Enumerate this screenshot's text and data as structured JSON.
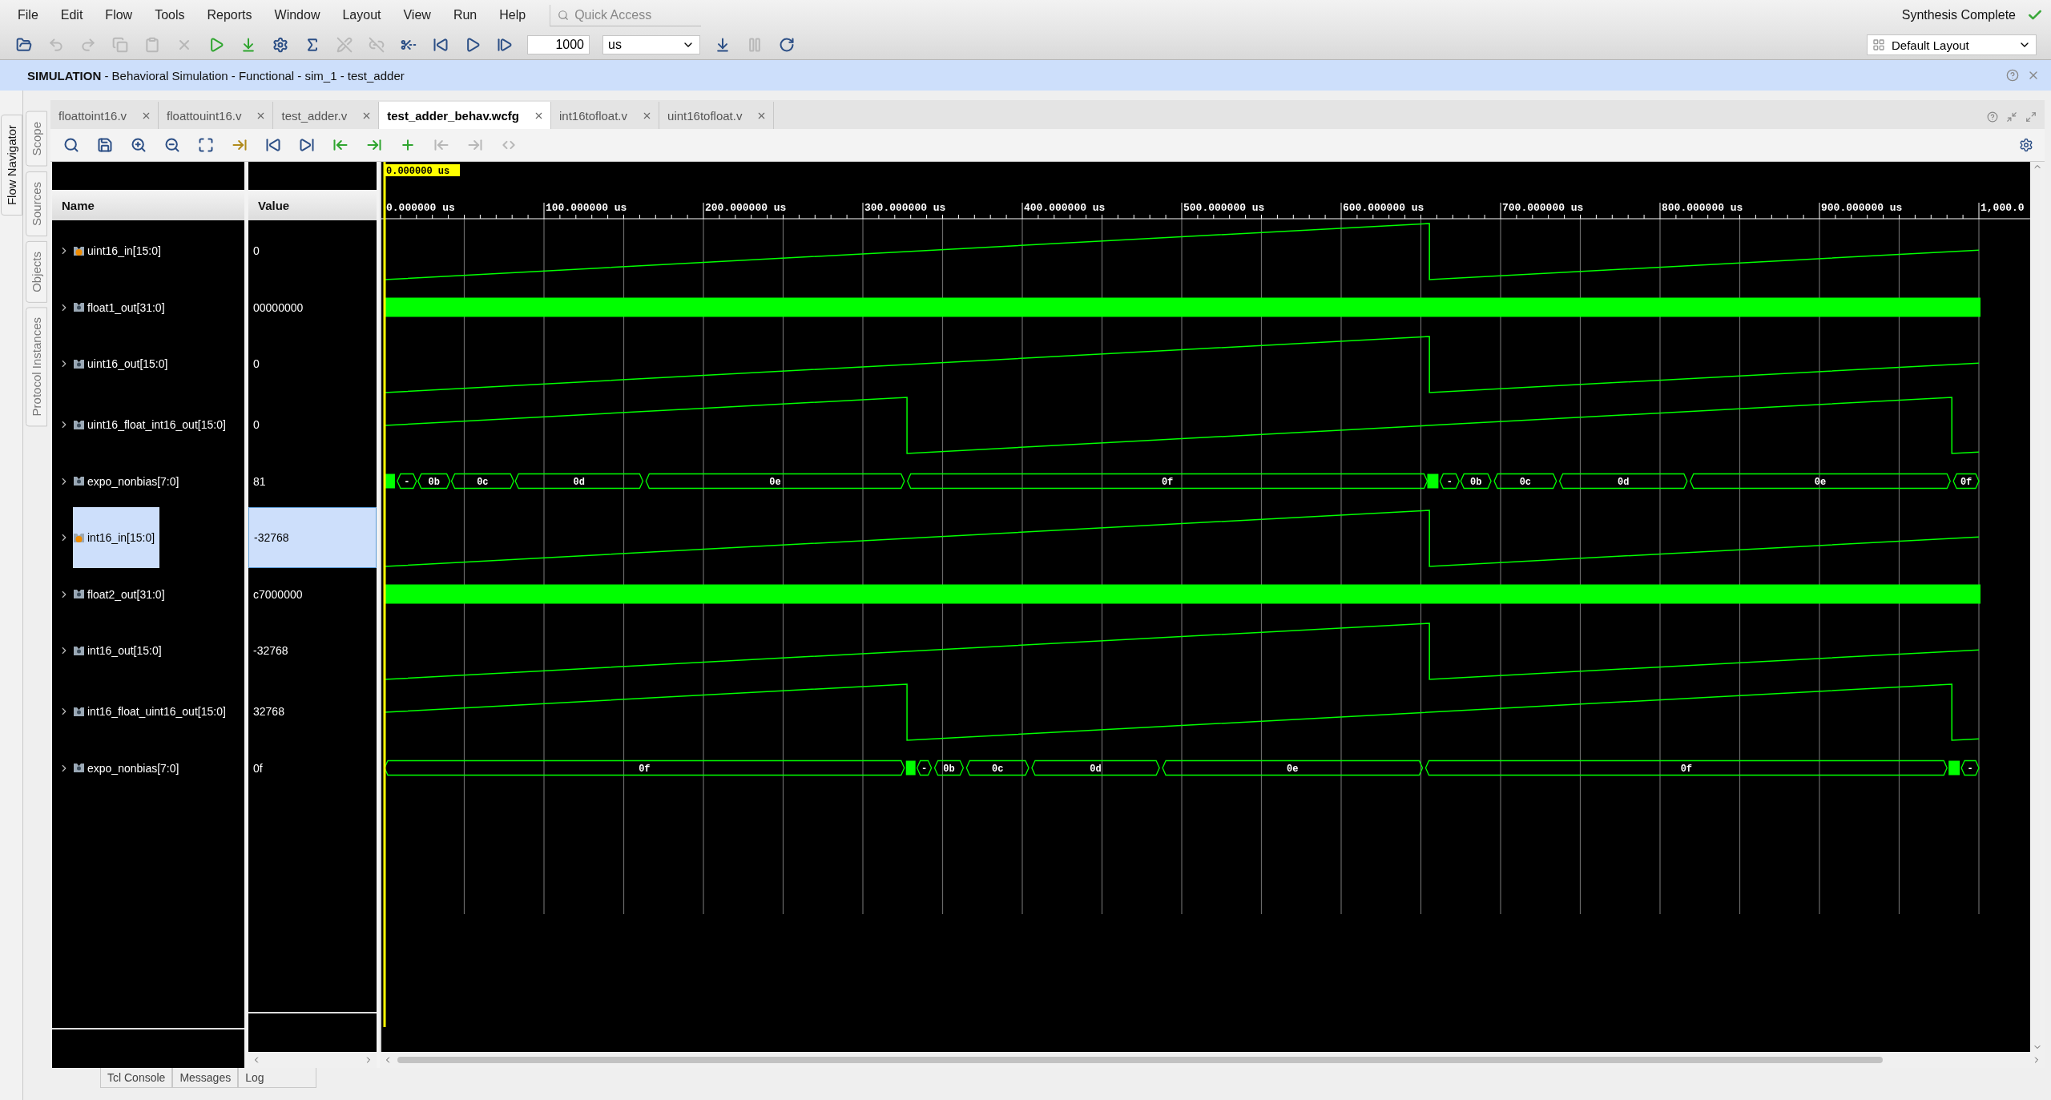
{
  "menu": [
    "File",
    "Edit",
    "Flow",
    "Tools",
    "Reports",
    "Window",
    "Layout",
    "View",
    "Run",
    "Help"
  ],
  "quick_access": {
    "placeholder": "Quick Access"
  },
  "status": "Synthesis Complete",
  "toolbar": [
    {
      "disabled": false
    },
    {
      "disabled": true
    },
    {
      "disabled": true
    },
    {
      "disabled": true
    },
    {
      "disabled": true
    },
    {
      "disabled": true
    },
    {
      "disabled": false
    },
    {
      "disabled": false
    },
    {
      "disabled": false
    },
    {
      "disabled": false
    },
    {
      "disabled": true
    },
    {
      "disabled": true
    },
    {
      "disabled": false
    },
    {
      "disabled": false
    },
    {
      "disabled": false
    },
    {
      "disabled": false
    }
  ],
  "run_time": {
    "value": "1000",
    "unit": "us"
  },
  "toolbar_right": [
    {
      "disabled": false
    },
    {
      "disabled": true
    },
    {
      "disabled": false
    }
  ],
  "layout_select": "Default Layout",
  "header": "**SIMULATION** - Behavioral Simulation - Functional - sim_1 - test_adder",
  "side_tabs": [
    "Flow Navigator"
  ],
  "panel_tabs": [
    "Scope",
    "Sources",
    "Objects",
    "Protocol Instances"
  ],
  "editor_tabs": [
    {
      "label": "floattoint16.v",
      "selected": false
    },
    {
      "label": "floattouint16.v",
      "selected": false
    },
    {
      "label": "test_adder.v",
      "selected": false
    },
    {
      "label": "test_adder_behav.wcfg",
      "selected": true
    },
    {
      "label": "int16tofloat.v",
      "selected": false
    },
    {
      "label": "uint16tofloat.v",
      "selected": false
    }
  ],
  "wave_toolbar": [
    {
      "disabled": false
    },
    {
      "disabled": false
    },
    {
      "disabled": false
    },
    {
      "disabled": false
    },
    {
      "disabled": false
    },
    {
      "disabled": false
    },
    {
      "disabled": false
    },
    {
      "disabled": false
    },
    {
      "disabled": false
    },
    {
      "disabled": false
    },
    {
      "disabled": false
    },
    {
      "disabled": true
    },
    {
      "disabled": true
    },
    {
      "disabled": true
    }
  ],
  "waveform": {
    "cursor": "0.000000 us",
    "columns": [
      "Name",
      "Value"
    ],
    "time_labels": [
      "0.000000 us",
      "100.000000 us",
      "200.000000 us",
      "300.000000 us",
      "400.000000 us",
      "500.000000 us",
      "600.000000 us",
      "700.000000 us",
      "800.000000 us",
      "900.000000 us",
      "1,000.0"
    ],
    "signals": [
      {
        "name": "uint16_in[15:0]",
        "value": "0",
        "kind": "analog",
        "input": true,
        "expanded": false,
        "selected": false
      },
      {
        "name": "float1_out[31:0]",
        "value": "00000000",
        "kind": "dense",
        "input": false,
        "expanded": false,
        "selected": false
      },
      {
        "name": "uint16_out[15:0]",
        "value": "0",
        "kind": "analog",
        "input": false,
        "expanded": false,
        "selected": false
      },
      {
        "name": "uint16_float_int16_out[15:0]",
        "value": "0",
        "kind": "analog",
        "input": false,
        "expanded": false,
        "selected": false
      },
      {
        "name": "expo_nonbias[7:0]",
        "value": "81",
        "kind": "bus",
        "input": false,
        "expanded": false,
        "selected": false,
        "segments": [
          "-",
          "0b",
          "0c",
          "0d",
          "0e",
          "0f",
          "-",
          "0b",
          "0c",
          "0d",
          "0e",
          "0f"
        ]
      },
      {
        "name": "int16_in[15:0]",
        "value": "-32768",
        "kind": "analog",
        "input": true,
        "expanded": false,
        "selected": true
      },
      {
        "name": "float2_out[31:0]",
        "value": "c7000000",
        "kind": "dense",
        "input": false,
        "expanded": false,
        "selected": false
      },
      {
        "name": "int16_out[15:0]",
        "value": "-32768",
        "kind": "analog",
        "input": false,
        "expanded": false,
        "selected": false
      },
      {
        "name": "int16_float_uint16_out[15:0]",
        "value": "32768",
        "kind": "analog",
        "input": false,
        "expanded": false,
        "selected": false
      },
      {
        "name": "expo_nonbias[7:0]",
        "value": "0f",
        "kind": "bus",
        "input": false,
        "expanded": false,
        "selected": false,
        "segments": [
          "0f",
          "-",
          "0b",
          "0c",
          "0d",
          "0e",
          "0f",
          "-"
        ]
      }
    ]
  },
  "bottom_tabs": [
    "Tcl Console",
    "Messages",
    "Log"
  ]
}
